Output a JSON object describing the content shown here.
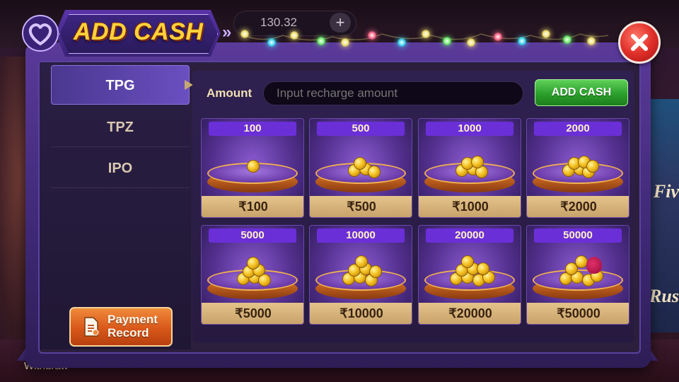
{
  "header": {
    "title": "ADD CASH"
  },
  "balance": {
    "amount": "130.32",
    "plus": "+"
  },
  "tabs": [
    {
      "label": "TPG",
      "active": true
    },
    {
      "label": "TPZ",
      "active": false
    },
    {
      "label": "IPO",
      "active": false
    }
  ],
  "payment_record": {
    "line1": "Payment",
    "line2": "Record"
  },
  "amount": {
    "label": "Amount",
    "placeholder": "Input recharge amount",
    "button": "ADD CASH"
  },
  "packages": [
    {
      "top": "100",
      "bottom": "₹100"
    },
    {
      "top": "500",
      "bottom": "₹500"
    },
    {
      "top": "1000",
      "bottom": "₹1000"
    },
    {
      "top": "2000",
      "bottom": "₹2000"
    },
    {
      "top": "5000",
      "bottom": "₹5000"
    },
    {
      "top": "10000",
      "bottom": "₹10000"
    },
    {
      "top": "20000",
      "bottom": "₹20000"
    },
    {
      "top": "50000",
      "bottom": "₹50000"
    }
  ],
  "background": {
    "right_text_1": "f Fiv",
    "right_text_2": "g Rus",
    "bottom_text": "Withdraw"
  },
  "colors": {
    "accent_gold": "#ffd23a",
    "add_cash_green": "#2aa02a",
    "close_red": "#e0302a",
    "modal_purple": "#3e2874"
  },
  "icons": [
    "heart-icon",
    "chevron-right-icon",
    "close-icon",
    "document-icon",
    "coin-stack-icon"
  ]
}
